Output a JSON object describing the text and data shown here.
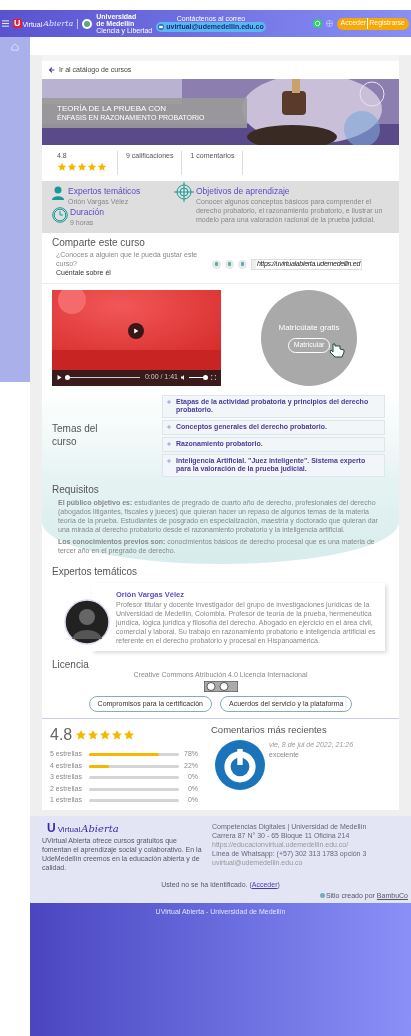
{
  "header": {
    "logo_mark": "U",
    "logo_word": "Virtual",
    "logo_script": "Abierta",
    "university_name": "Universidad de Medellín",
    "university_tagline": "Ciencia y Libertad",
    "contact_label": "Contáctenos al correo",
    "contact_email": "uvirtual@udemedellin.edu.co",
    "buttons": [
      "Acceder",
      "Registrarse"
    ]
  },
  "back_link": "Ir al catálogo de cursos",
  "banner": {
    "kind": "picture",
    "title": "TEORÍA DE LA PRUEBA CON",
    "subtitle": "ÉNFASIS EN RAZONAMIENTO PROBATORIO"
  },
  "stats": {
    "rating": "4.8",
    "stars": 5,
    "ratings_count": "9 calificaciones",
    "comments_count": "1 comentarios"
  },
  "info": {
    "experts_title": "Expertos temáticos",
    "experts_value": "Orión Vargas Vélez",
    "duration_title": "Duración",
    "duration_value": "9 horas",
    "objectives_title": "Objetivos de aprendizaje",
    "objectives_text": "Conocer algunos conceptos básicos para comprender el derecho probatorio, el razonamiento probatorio, e ilustrar un modelo para una valoración racional de la prueba judicial."
  },
  "share": {
    "title": "Comparte este curso",
    "prompt": "¿Conoces a alguien que le pueda gustar este curso?",
    "cta": "Cuéntale sobre él",
    "url": "https://uvirtualabierta.udemedellin.ed"
  },
  "video": {
    "time": "0:00 / 1:41",
    "progress": {
      "level": 0
    },
    "volume": {
      "level": 1
    }
  },
  "enroll": {
    "title": "Matricúlate gratis",
    "button": "Matricular"
  },
  "topics": {
    "title": "Temas del curso",
    "items": [
      {
        "text": "Etapas de la actividad probatoria y principios del derecho probatorio."
      },
      {
        "text": "Conceptos generales del derecho probatorio."
      },
      {
        "text": "Razonamiento probatorio."
      },
      {
        "text": "Inteligencia Artificial. \"Juez inteligente\". Sistema experto para la valoración de la prueba judicial."
      }
    ]
  },
  "requirements": {
    "title": "Requisitos",
    "paragraphs": [
      "**El público objetivo es:** estudiantes de pregrado de cuarto año de derecho, profesionales del derecho (abogados litigantes, fiscales y jueces) que quieran hacer un repaso de algunos temas de la materia teoría de la prueba. Estudiantes de posgrado en especialización, maestría y doctorado que quieran dar una mirada al derecho probatorio desde el razonamiento probatorio y la inteligencia artificial.",
      "**Los conocimientos previos son:** conocimientos básicos de derecho procesal que es una materia de tercer año en el pregrado de derecho."
    ]
  },
  "experts": {
    "title": "Expertos temáticos",
    "people": [
      {
        "name": "Orión Vargas Vélez",
        "bio": "Profesor titular y docente investigador del grupo de investigaciones jurídicas de la Universidad de Medellín, Colombia. Profesor de teoría de la prueba, hermenéutica jurídica, lógica jurídica y filosofía del derecho. Abogado en ejercicio en el área civil, comercial y laboral. Su trabajo en razonamiento probatorio e inteligencia artificial es referente en el derecho probatorio y procesal en Hispanoamérica."
      }
    ]
  },
  "license": {
    "title": "Licencia",
    "text": "Creative Commons Atribución 4.0 Licencia Internacional",
    "buttons": [
      "Compromisos para la certificación",
      "Acuerdos del servicio y la plataforma"
    ]
  },
  "reviews": {
    "average": "4.8",
    "stars": 5,
    "breakdown": [
      {
        "label": "5 estrellas",
        "level": 0.78,
        "percent": "78%"
      },
      {
        "label": "4 estrellas",
        "level": 0.22,
        "percent": "22%"
      },
      {
        "label": "3 estrellas",
        "level": 0,
        "percent": "0%"
      },
      {
        "label": "2 estrellas",
        "level": 0,
        "percent": "0%"
      },
      {
        "label": "1 estrellas",
        "level": 0,
        "percent": "0%"
      }
    ],
    "comments_title": "Comentarios más recientes",
    "comments": [
      {
        "date": "vie, 8 de jul de 2022, 21:26",
        "text": "excelente"
      }
    ]
  },
  "footer": {
    "logo_mark": "U",
    "logo_word": "Virtual",
    "logo_script": "Abierta",
    "about": "UVirtual Abierta ofrece cursos gratuitos que fomentan el aprendizaje social y colaborativo. En la UdeMedellín creemos en la educación abierta y de calidad.",
    "contact_title": "Competencias Digitales | Universidad de Medellín",
    "contact": [
      "Carrera 87 N° 30 - 65 Bloque 11 Oficina 214",
      "https://educacionvirtual.udemedellin.edu.co/",
      "Línea de Whatsapp: (+57) 302 313 1783 opción 3",
      "uvirtual@udemedellin.edu.co"
    ],
    "login_prefix": "Usted no se ha identificado. (",
    "login_link": "Acceder",
    "login_suffix": ")",
    "credit": "Sitio creado por",
    "credit_link": "BambuCo",
    "bottom": "UVirtual Abierta - Universidad de Medellín"
  }
}
